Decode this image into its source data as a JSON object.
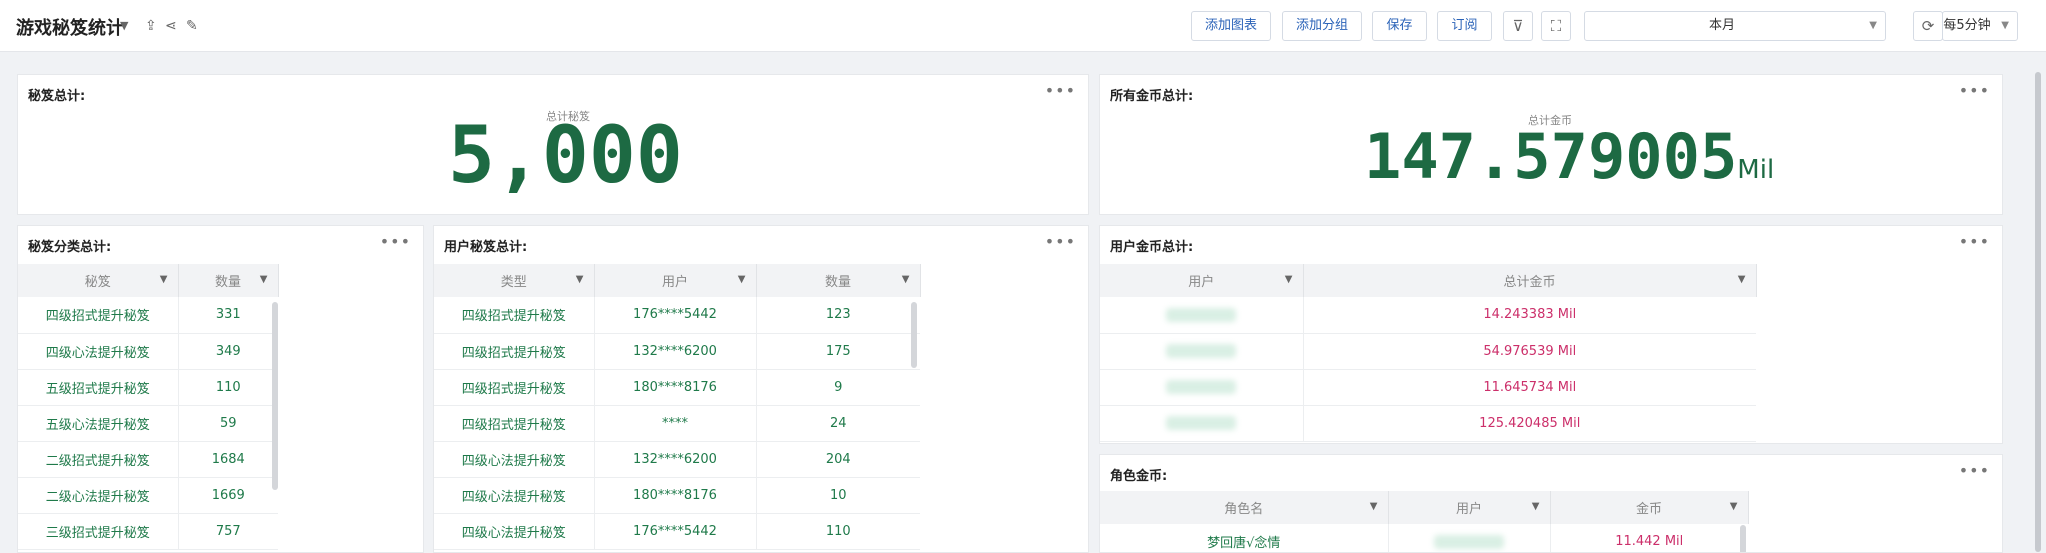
{
  "header": {
    "title": "游戏秘笈统计",
    "buttons": {
      "add_chart": "添加图表",
      "add_group": "添加分组",
      "save": "保存",
      "subscribe": "订阅"
    },
    "date_range": "本月",
    "refresh_interval": "每5分钟"
  },
  "kpi_total": {
    "title": "秘笈总计:",
    "label": "总计秘笈",
    "value": "5,000"
  },
  "kpi_coins": {
    "title": "所有金币总计:",
    "label": "总计金币",
    "value": "147.579005",
    "unit": "Mil"
  },
  "category_table": {
    "title": "秘笈分类总计:",
    "columns": [
      "秘笈",
      "数量"
    ],
    "rows": [
      [
        "四级招式提升秘笈",
        "331"
      ],
      [
        "四级心法提升秘笈",
        "349"
      ],
      [
        "五级招式提升秘笈",
        "110"
      ],
      [
        "五级心法提升秘笈",
        "59"
      ],
      [
        "二级招式提升秘笈",
        "1684"
      ],
      [
        "二级心法提升秘笈",
        "1669"
      ],
      [
        "三级招式提升秘笈",
        "757"
      ]
    ]
  },
  "user_table": {
    "title": "用户秘笈总计:",
    "columns": [
      "类型",
      "用户",
      "数量"
    ],
    "rows": [
      [
        "四级招式提升秘笈",
        "176****5442",
        "123"
      ],
      [
        "四级招式提升秘笈",
        "132****6200",
        "175"
      ],
      [
        "四级招式提升秘笈",
        "180****8176",
        "9"
      ],
      [
        "四级招式提升秘笈",
        "****",
        "24"
      ],
      [
        "四级心法提升秘笈",
        "132****6200",
        "204"
      ],
      [
        "四级心法提升秘笈",
        "180****8176",
        "10"
      ],
      [
        "四级心法提升秘笈",
        "176****5442",
        "110"
      ]
    ]
  },
  "user_coins_table": {
    "title": "用户金币总计:",
    "columns": [
      "用户",
      "总计金币"
    ],
    "rows": [
      "14.243383 Mil",
      "54.976539 Mil",
      "11.645734 Mil",
      "125.420485 Mil"
    ]
  },
  "role_coins_table": {
    "title": "角色金币:",
    "columns": [
      "角色名",
      "用户",
      "金币"
    ],
    "rows": [
      [
        "梦回唐√念情",
        "11.442 Mil"
      ]
    ]
  },
  "colors": {
    "accent_green": "#1d6a43",
    "coin_red": "#cc2f6a",
    "link_blue": "#2b63b8"
  }
}
